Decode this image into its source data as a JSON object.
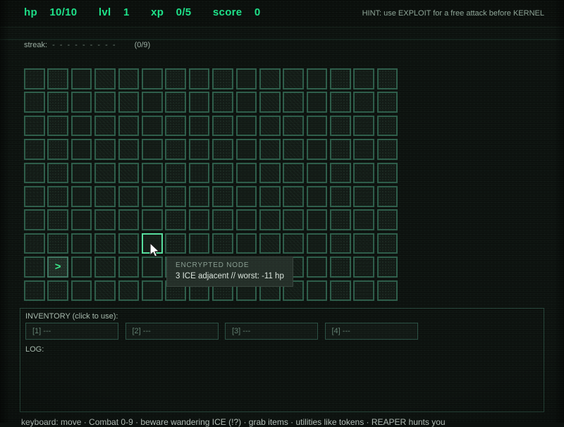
{
  "header": {
    "hp_label": "hp",
    "hp_value": "10/10",
    "lvl_label": "lvl",
    "lvl_value": "1",
    "xp_label": "xp",
    "xp_value": "0/5",
    "score_label": "score",
    "score_value": "0",
    "hint": "HINT: use EXPLOIT for a free attack before KERNEL"
  },
  "streak": {
    "label": "streak:",
    "dashes": "- - - - - - - - -",
    "count": "(0/9)"
  },
  "grid": {
    "cols": 16,
    "rows": 10,
    "player": {
      "row": 9,
      "col": 2,
      "glyph": ">"
    },
    "hover": {
      "row": 8,
      "col": 6
    }
  },
  "tooltip": {
    "title": "ENCRYPTED NODE",
    "body": "3 ICE adjacent // worst: -11 hp"
  },
  "inventory": {
    "label": "INVENTORY (click to use):",
    "slots": [
      "[1] ---",
      "[2] ---",
      "[3] ---",
      "[4] ---"
    ]
  },
  "log": {
    "label": "LOG:",
    "entries": []
  },
  "footer": {
    "legend": "keyboard: move · Combat 0-9 · beware wandering ICE (!?) · grab items · utilities like tokens · REAPER hunts you"
  },
  "colors": {
    "accent": "#1de289",
    "grid_border": "#2d5c49",
    "highlight": "#56dd9d",
    "player_glyph": "#3ae98a"
  }
}
